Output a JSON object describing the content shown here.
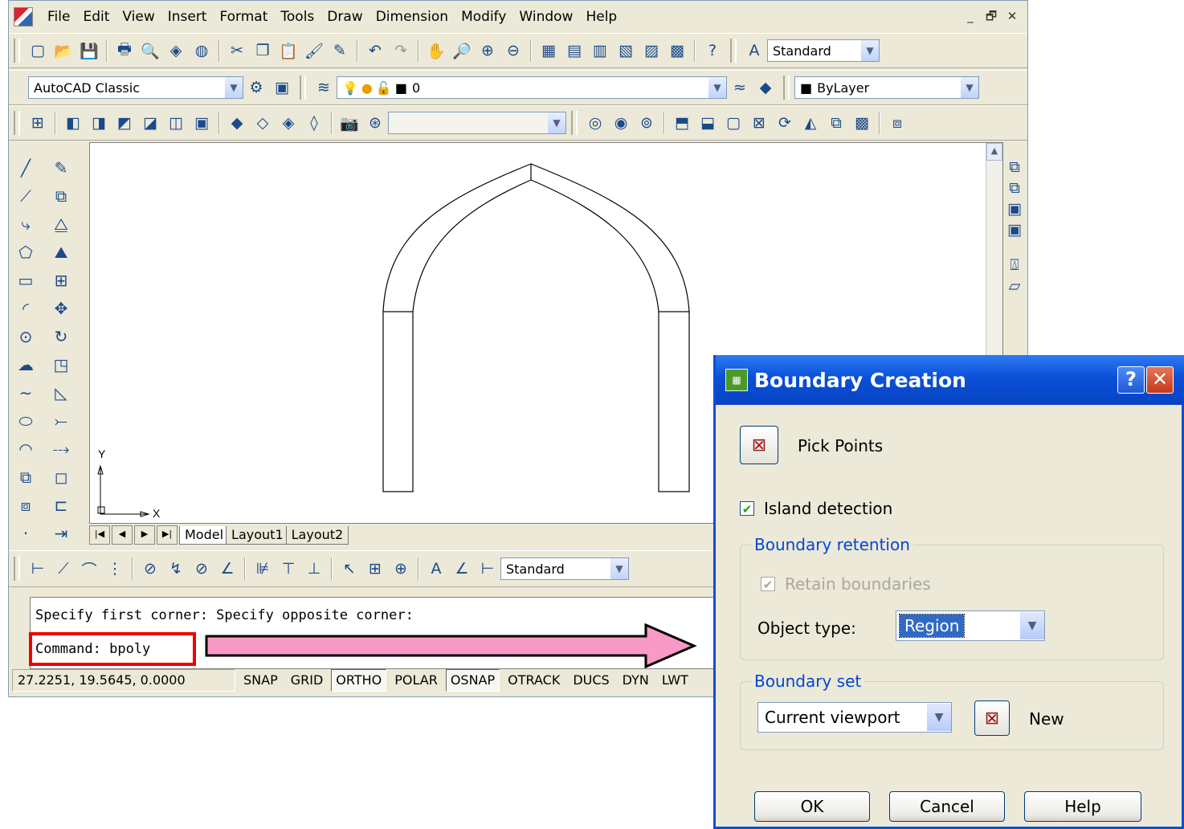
{
  "menu": [
    "File",
    "Edit",
    "View",
    "Insert",
    "Format",
    "Tools",
    "Draw",
    "Dimension",
    "Modify",
    "Window",
    "Help"
  ],
  "window_controls": [
    "_",
    "🗗",
    "✕"
  ],
  "toolbar": {
    "text_style": "Standard",
    "workspace": "AutoCAD Classic",
    "layer": "0",
    "color": "ByLayer",
    "dim_style": "Standard"
  },
  "layout_tabs": [
    "Model",
    "Layout1",
    "Layout2"
  ],
  "ucs": {
    "y_label": "Y",
    "x_label": "X"
  },
  "command": {
    "line1": "Specify first corner: Specify opposite corner:",
    "line2": "Command: bpoly"
  },
  "status": {
    "coords": "27.2251, 19.5645, 0.0000",
    "buttons": [
      {
        "label": "SNAP",
        "on": false
      },
      {
        "label": "GRID",
        "on": false
      },
      {
        "label": "ORTHO",
        "on": true
      },
      {
        "label": "POLAR",
        "on": false
      },
      {
        "label": "OSNAP",
        "on": true
      },
      {
        "label": "OTRACK",
        "on": false
      },
      {
        "label": "DUCS",
        "on": false
      },
      {
        "label": "DYN",
        "on": false
      },
      {
        "label": "LWT",
        "on": false
      }
    ]
  },
  "dialog": {
    "title": "Boundary Creation",
    "pick_points": "Pick Points",
    "island_detection": "Island detection",
    "boundary_retention": "Boundary retention",
    "retain_boundaries": "Retain boundaries",
    "object_type_label": "Object type:",
    "object_type_value": "Region",
    "boundary_set": "Boundary set",
    "boundary_set_value": "Current viewport",
    "new_label": "New",
    "ok": "OK",
    "cancel": "Cancel",
    "help": "Help"
  },
  "colors": {
    "highlight_box": "#ee0000",
    "arrow_fill": "#f999c6",
    "title_blue": "#0a50d8"
  }
}
